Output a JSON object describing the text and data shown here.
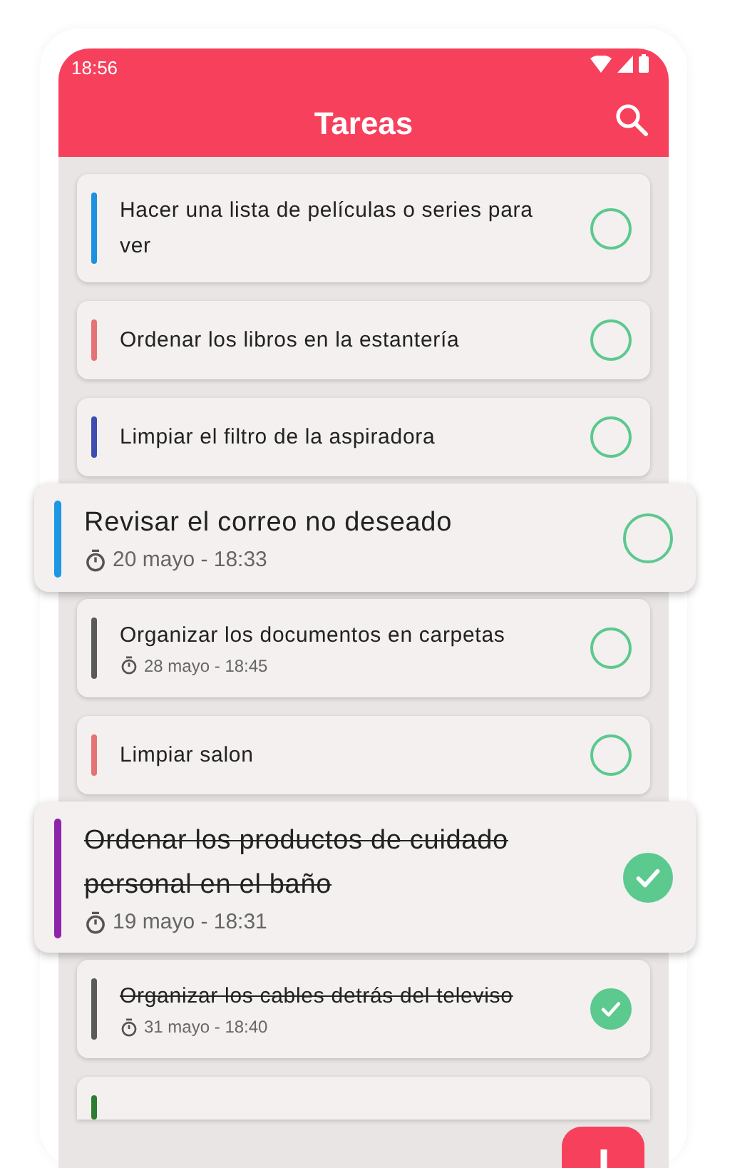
{
  "status_bar": {
    "time": "18:56"
  },
  "app_bar": {
    "title": "Tareas"
  },
  "tasks": [
    {
      "kind": "normal",
      "title": "Hacer una lista de películas o series para ver",
      "color": "#1e90e0",
      "done": false
    },
    {
      "kind": "normal",
      "title": "Ordenar los libros en la estantería",
      "color": "#e57373",
      "done": false
    },
    {
      "kind": "normal",
      "title": "Limpiar el filtro de la aspiradora",
      "color": "#3f4db0",
      "done": false
    },
    {
      "kind": "large",
      "title": "Revisar el correo no deseado",
      "date": "20 mayo - 18:33",
      "color": "#1e96e6",
      "done": false
    },
    {
      "kind": "normal",
      "title": "Organizar los documentos en carpetas",
      "date": "28 mayo - 18:45",
      "color": "#5a5a5a",
      "done": false
    },
    {
      "kind": "normal",
      "title": "Limpiar salon",
      "color": "#e57373",
      "done": false
    },
    {
      "kind": "large",
      "title": "Ordenar los productos de cuidado personal en el baño",
      "date": "19 mayo - 18:31",
      "color": "#8e24aa",
      "done": true
    },
    {
      "kind": "normal",
      "title": "Organizar los cables detrás del televiso",
      "date": "31 mayo - 18:40",
      "color": "#5a5a5a",
      "done": true
    },
    {
      "kind": "cut",
      "color": "#2e7d32"
    }
  ]
}
